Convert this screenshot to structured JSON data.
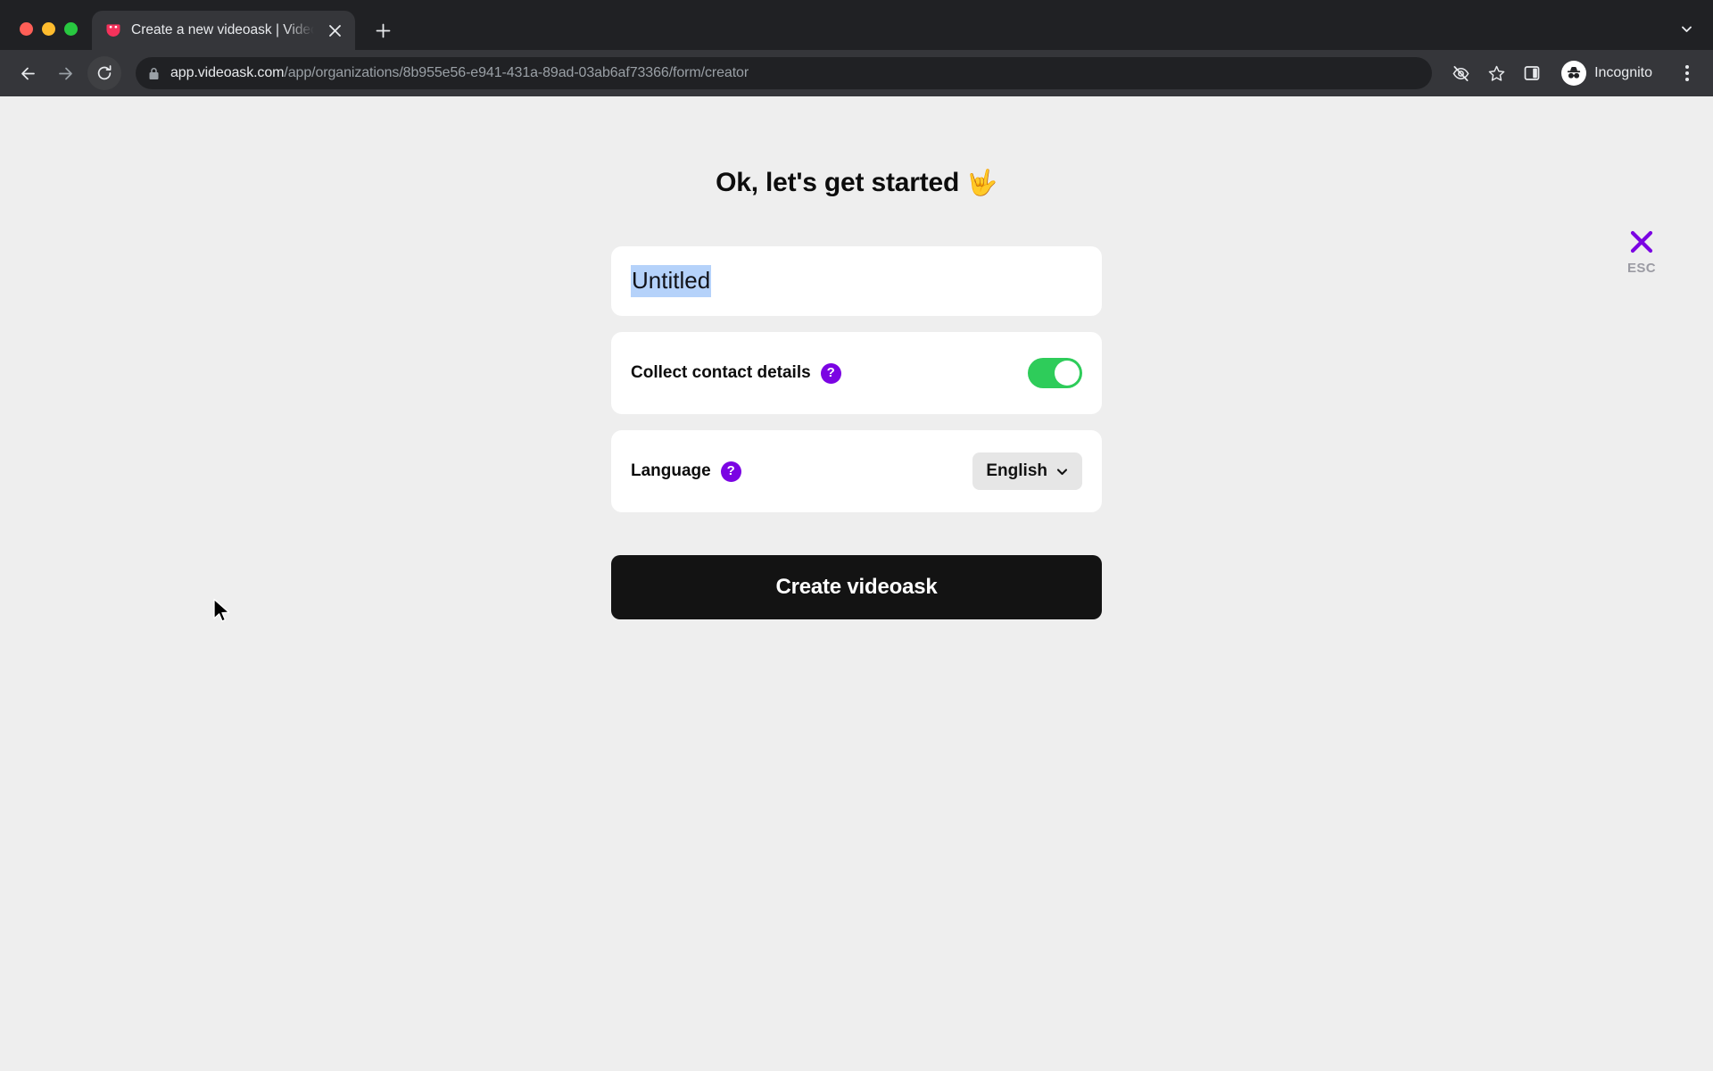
{
  "browser": {
    "window_controls": [
      "close",
      "minimize",
      "maximize"
    ],
    "tab": {
      "title": "Create a new videoask | Video",
      "favicon": "videoask-smiley-icon",
      "close_icon": "close-icon"
    },
    "new_tab_label": "+",
    "tab_search_icon": "chevron-down-icon",
    "nav": {
      "back_icon": "back-arrow-icon",
      "forward_icon": "forward-arrow-icon",
      "reload_icon": "reload-icon"
    },
    "omnibox": {
      "lock_icon": "lock-icon",
      "url_host": "app.videoask.com",
      "url_path": "/app/organizations/8b955e56-e941-431a-89ad-03ab6af73366/form/creator"
    },
    "toolbar_right": {
      "tracking_protection_icon": "eye-slash-icon",
      "bookmark_icon": "star-icon",
      "side_panel_icon": "side-panel-icon",
      "profile_label": "Incognito",
      "profile_avatar_icon": "incognito-hat-icon",
      "menu_icon": "three-dot-menu-icon"
    }
  },
  "page": {
    "esc": {
      "close_icon": "close-x-icon",
      "label": "ESC",
      "icon_color": "#7b04e3",
      "label_color": "#9b9ba3"
    },
    "title": "Ok, let's get started",
    "title_emoji": "🤟",
    "title_input": {
      "value": "Untitled",
      "selected": true,
      "selection_color": "#b5d2fa"
    },
    "rows": [
      {
        "label": "Collect contact details",
        "help_icon": "question-mark-icon",
        "control": "toggle",
        "toggle_on": true,
        "toggle_color": "#2ecc5a"
      },
      {
        "label": "Language",
        "help_icon": "question-mark-icon",
        "control": "select",
        "selected_value": "English",
        "chevron_icon": "chevron-down-icon"
      }
    ],
    "submit_label": "Create videoask",
    "colors": {
      "background": "#eeeeee",
      "card": "#ffffff",
      "accent_purple": "#7b04e3",
      "button_dark": "#131313"
    }
  }
}
